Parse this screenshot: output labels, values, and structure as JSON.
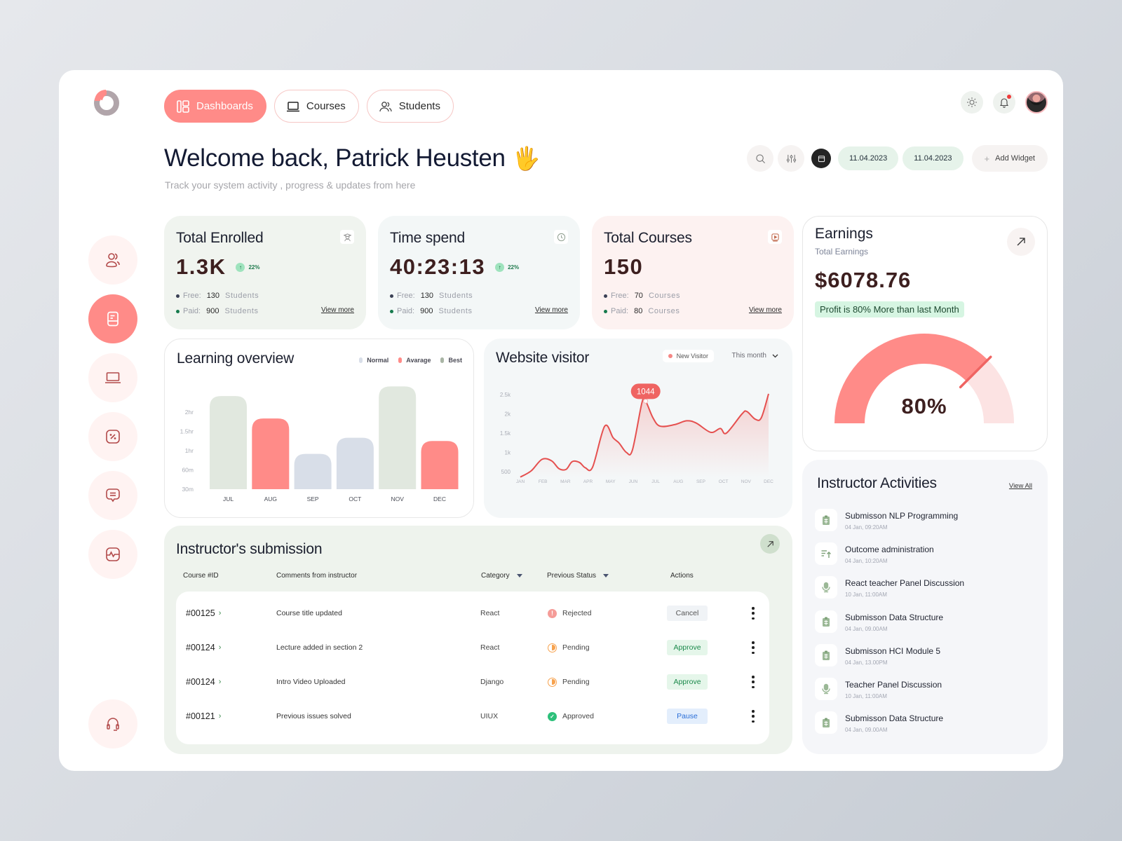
{
  "nav": {
    "tabs": [
      {
        "label": "Dashboards",
        "icon": "dashboard-icon",
        "active": true
      },
      {
        "label": "Courses",
        "icon": "laptop-icon",
        "active": false
      },
      {
        "label": "Students",
        "icon": "users-icon",
        "active": false
      }
    ]
  },
  "header": {
    "welcome": "Welcome back, Patrick Heusten",
    "emoji": "🖐",
    "subtitle": "Track your system activity , progress & updates from here"
  },
  "filters": {
    "date_from": "11.04.2023",
    "date_to": "11.04.2023",
    "add_widget": "Add Widget"
  },
  "sidebar": {
    "items": [
      {
        "name": "users",
        "icon": "users-icon",
        "active": false
      },
      {
        "name": "submissions",
        "icon": "document-icon",
        "active": true
      },
      {
        "name": "courses",
        "icon": "laptop-icon",
        "active": false
      },
      {
        "name": "discounts",
        "icon": "percent-icon",
        "active": false
      },
      {
        "name": "messages",
        "icon": "chat-icon",
        "active": false
      },
      {
        "name": "activity",
        "icon": "pulse-icon",
        "active": false
      }
    ],
    "support_icon": "headset-icon"
  },
  "stats": {
    "enrolled": {
      "title": "Total Enrolled",
      "value": "1.3K",
      "growth": "22%",
      "free_label": "Free:",
      "free_num": "130",
      "free_unit": "Students",
      "paid_label": "Paid:",
      "paid_num": "900",
      "paid_unit": "Students",
      "view_more": "View more"
    },
    "time": {
      "title": "Time spend",
      "value": "40:23:13",
      "growth": "22%",
      "free_label": "Free:",
      "free_num": "130",
      "free_unit": "Students",
      "paid_label": "Paid:",
      "paid_num": "900",
      "paid_unit": "Students",
      "view_more": "View more"
    },
    "courses": {
      "title": "Total Courses",
      "value": "150",
      "free_label": "Free:",
      "free_num": "70",
      "free_unit": "Courses",
      "paid_label": "Paid:",
      "paid_num": "80",
      "paid_unit": "Courses",
      "view_more": "View more"
    }
  },
  "earnings": {
    "title": "Earnings",
    "subtitle": "Total Earnings",
    "amount": "$6078.76",
    "profit_note": "Profit is 80% More than last Month",
    "gauge_percent": 80,
    "gauge_label": "80%"
  },
  "colors": {
    "accent": "#ff8b88",
    "accent_light": "#fce3e3",
    "normal": "#d8dee8",
    "best": "#e1e8df",
    "best_legend": "#a9b5a5",
    "line": "#e5504f"
  },
  "chart_data": [
    {
      "type": "bar",
      "title": "Learning overview",
      "categories": [
        "JUL",
        "AUG",
        "SEP",
        "OCT",
        "NOV",
        "DEC"
      ],
      "values_minutes": [
        175,
        140,
        85,
        110,
        190,
        105
      ],
      "bar_class": [
        "Best",
        "Avarage",
        "Normal",
        "Normal",
        "Best",
        "Avarage"
      ],
      "legend": [
        "Normal",
        "Avarage",
        "Best"
      ],
      "y_ticks": [
        "30m",
        "60m",
        "1hr",
        "1.5hr",
        "2hr"
      ],
      "xlabel": "",
      "ylabel": ""
    },
    {
      "type": "line",
      "title": "Website visitor",
      "legend": [
        "New Visitor"
      ],
      "period": "This month",
      "x": [
        "JAN",
        "FEB",
        "MAR",
        "APR",
        "MAY",
        "JUN",
        "JUL",
        "AUG",
        "SEP",
        "OCT",
        "NOV",
        "DEC"
      ],
      "y_ticks": [
        "500",
        "1k",
        "1.5k",
        "2k",
        "2.5k"
      ],
      "points": [
        [
          0,
          360
        ],
        [
          0.45,
          520
        ],
        [
          0.9,
          820
        ],
        [
          1.3,
          780
        ],
        [
          1.6,
          580
        ],
        [
          1.9,
          560
        ],
        [
          2.15,
          760
        ],
        [
          2.45,
          740
        ],
        [
          2.7,
          600
        ],
        [
          3.0,
          620
        ],
        [
          3.5,
          1680
        ],
        [
          3.85,
          1380
        ],
        [
          4.1,
          1240
        ],
        [
          4.4,
          1000
        ],
        [
          4.65,
          1060
        ],
        [
          5.05,
          2300
        ],
        [
          5.2,
          2330
        ],
        [
          5.5,
          1900
        ],
        [
          5.8,
          1680
        ],
        [
          6.4,
          1720
        ],
        [
          6.9,
          1820
        ],
        [
          7.3,
          1760
        ],
        [
          7.9,
          1520
        ],
        [
          8.3,
          1620
        ],
        [
          8.55,
          1500
        ],
        [
          9.2,
          2000
        ],
        [
          9.4,
          2060
        ],
        [
          9.75,
          1860
        ],
        [
          10.0,
          1900
        ],
        [
          10.3,
          2520
        ]
      ],
      "highlight": {
        "x": 5.2,
        "y": 2330,
        "label": "1044"
      },
      "ylim": [
        300,
        2700
      ]
    }
  ],
  "submissions": {
    "title": "Instructor's submission",
    "columns": [
      "Course #ID",
      "Comments from instructor",
      "Category",
      "Previous Status",
      "Actions"
    ],
    "rows": [
      {
        "id": "#00125",
        "comment": "Course title updated",
        "category": "React",
        "status": "Rejected",
        "status_type": "rej",
        "action": "Cancel",
        "action_type": "cancel"
      },
      {
        "id": "#00124",
        "comment": "Lecture added in section 2",
        "category": "React",
        "status": "Pending",
        "status_type": "pen",
        "action": "Approve",
        "action_type": "approve"
      },
      {
        "id": "#00124",
        "comment": "Intro Video Uploaded",
        "category": "Django",
        "status": "Pending",
        "status_type": "pen",
        "action": "Approve",
        "action_type": "approve"
      },
      {
        "id": "#00121",
        "comment": "Previous issues solved",
        "category": "UIUX",
        "status": "Approved",
        "status_type": "app",
        "action": "Pause",
        "action_type": "pause"
      }
    ]
  },
  "activities": {
    "title": "Instructor Activities",
    "view_all": "View All",
    "items": [
      {
        "name": "Submisson NLP Programming",
        "date": "04 Jan, 09:20AM",
        "icon": "clipboard-icon"
      },
      {
        "name": "Outcome administration",
        "date": "04 Jan, 10:20AM",
        "icon": "sort-up-icon"
      },
      {
        "name": "React teacher Panel Discussion",
        "date": "10 Jan, 11:00AM",
        "icon": "microphone-icon"
      },
      {
        "name": "Submisson Data Structure",
        "date": "04 Jan, 09.00AM",
        "icon": "clipboard-icon"
      },
      {
        "name": "Submisson HCI Module 5",
        "date": "04 Jan, 13.00PM",
        "icon": "clipboard-icon"
      },
      {
        "name": "Teacher Panel Discussion",
        "date": "10 Jan, 11:00AM",
        "icon": "microphone-icon"
      },
      {
        "name": "Submisson Data Structure",
        "date": "04 Jan, 09.00AM",
        "icon": "clipboard-icon"
      }
    ]
  }
}
